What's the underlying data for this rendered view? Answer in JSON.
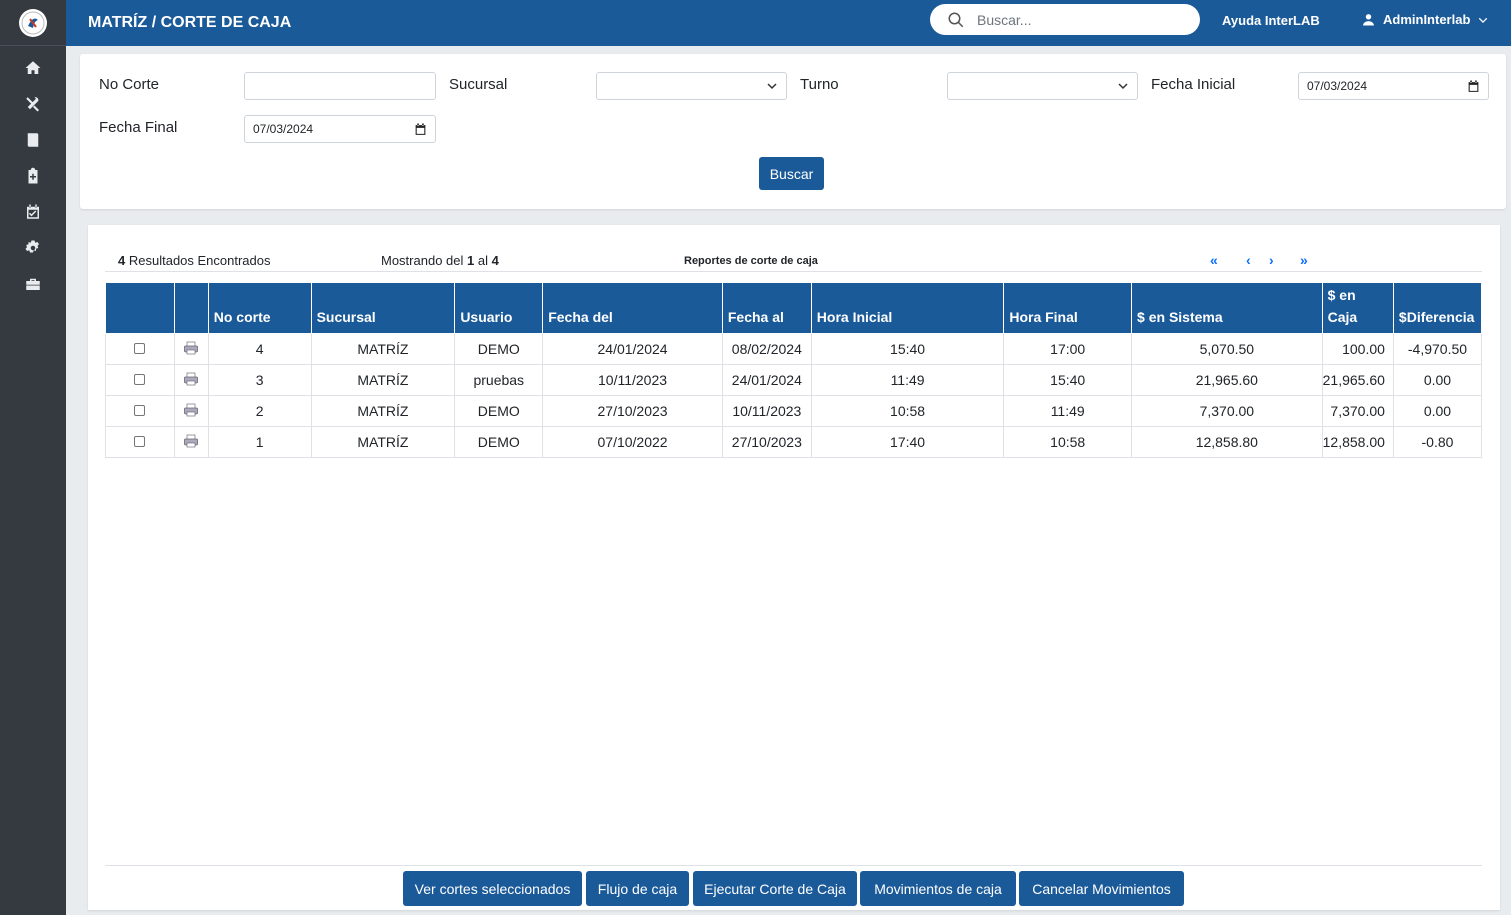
{
  "header": {
    "title": "MATRÍZ / CORTE DE CAJA",
    "search_placeholder": "Buscar...",
    "help_label": "Ayuda InterLAB",
    "user_label": "AdminInterlab"
  },
  "sidebar": {
    "items": [
      "home-icon",
      "tools-icon",
      "book-icon",
      "clipboard-medical-icon",
      "calendar-check-icon",
      "gear-icon",
      "toolbox-icon"
    ]
  },
  "filters": {
    "no_corte_label": "No Corte",
    "no_corte_value": "",
    "sucursal_label": "Sucursal",
    "sucursal_value": "",
    "turno_label": "Turno",
    "turno_value": "",
    "fecha_inicial_label": "Fecha Inicial",
    "fecha_inicial_value": "07/03/2024",
    "fecha_final_label": "Fecha Final",
    "fecha_final_value": "07/03/2024",
    "search_button": "Buscar"
  },
  "results": {
    "count": "4",
    "count_label": "Resultados Encontrados",
    "showing_prefix": "Mostrando del",
    "showing_from": "1",
    "showing_mid": "al",
    "showing_to": "4",
    "report_title": "Reportes de corte de caja",
    "pager": {
      "first": "«",
      "prev": "‹",
      "next": "›",
      "last": "»"
    }
  },
  "table": {
    "columns": [
      "",
      "",
      "No corte",
      "Sucursal",
      "Usuario",
      "Fecha del",
      "Fecha al",
      "Hora Inicial",
      "Hora Final",
      "$ en Sistema",
      "$ en Caja",
      "$Diferencia"
    ],
    "rows": [
      {
        "no_corte": "4",
        "sucursal": "MATRÍZ",
        "usuario": "DEMO",
        "fecha_del": "24/01/2024",
        "fecha_al": "08/02/2024",
        "hora_inicial": "15:40",
        "hora_final": "17:00",
        "sistema": "5,070.50",
        "caja": "100.00",
        "diferencia": "-4,970.50"
      },
      {
        "no_corte": "3",
        "sucursal": "MATRÍZ",
        "usuario": "pruebas",
        "fecha_del": "10/11/2023",
        "fecha_al": "24/01/2024",
        "hora_inicial": "11:49",
        "hora_final": "15:40",
        "sistema": "21,965.60",
        "caja": "21,965.60",
        "diferencia": "0.00"
      },
      {
        "no_corte": "2",
        "sucursal": "MATRÍZ",
        "usuario": "DEMO",
        "fecha_del": "27/10/2023",
        "fecha_al": "10/11/2023",
        "hora_inicial": "10:58",
        "hora_final": "11:49",
        "sistema": "7,370.00",
        "caja": "7,370.00",
        "diferencia": "0.00"
      },
      {
        "no_corte": "1",
        "sucursal": "MATRÍZ",
        "usuario": "DEMO",
        "fecha_del": "07/10/2022",
        "fecha_al": "27/10/2023",
        "hora_inicial": "17:40",
        "hora_final": "10:58",
        "sistema": "12,858.80",
        "caja": "12,858.00",
        "diferencia": "-0.80"
      }
    ]
  },
  "actions": {
    "ver_cortes": "Ver cortes seleccionados",
    "flujo": "Flujo de caja",
    "ejecutar": "Ejecutar Corte de Caja",
    "movimientos": "Movimientos de caja",
    "cancelar": "Cancelar Movimientos"
  },
  "colors": {
    "primary": "#1b5a99",
    "sidebar": "#343a40",
    "link": "#0d6efd"
  }
}
